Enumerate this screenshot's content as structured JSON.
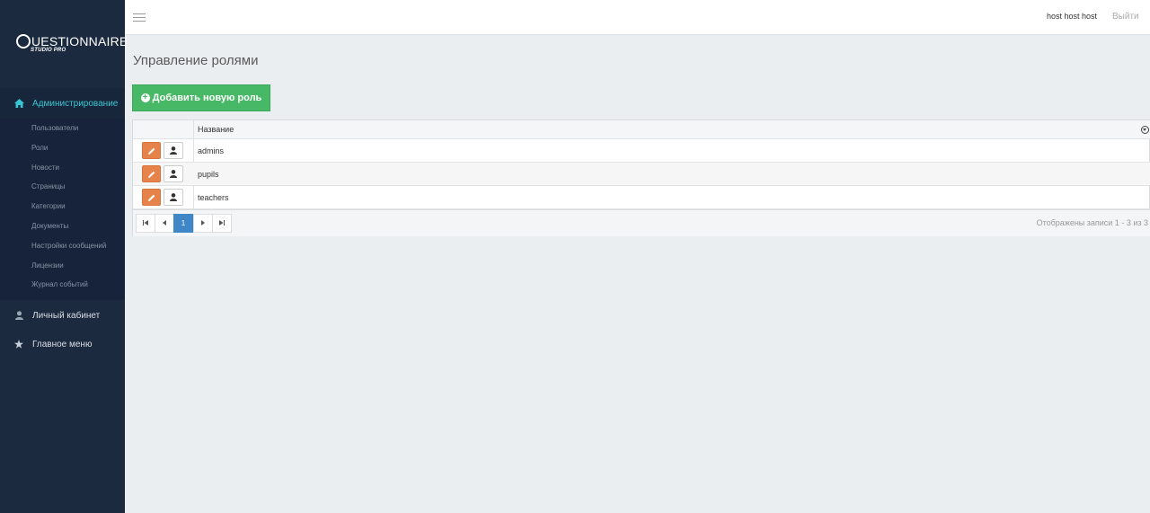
{
  "brand": {
    "name": "UESTIONNAIRE",
    "sub": "STUDIO PRO"
  },
  "header": {
    "user_name": "host host host",
    "logout": "Выйти"
  },
  "sidebar": {
    "admin": {
      "label": "Администрирование",
      "icon": "home-icon"
    },
    "sub_items": [
      "Пользователи",
      "Роли",
      "Новости",
      "Страницы",
      "Категории",
      "Документы",
      "Настройки сообщений",
      "Лицензии",
      "Журнал событий"
    ],
    "profile": {
      "label": "Личный кабинет",
      "icon": "user-icon"
    },
    "main_menu": {
      "label": "Главное меню",
      "icon": "star-icon"
    }
  },
  "main": {
    "title": "Управление ролями",
    "add_button": "Добавить новую роль",
    "grid": {
      "column_name": "Название",
      "rows": [
        "admins",
        "pupils",
        "teachers"
      ]
    },
    "pager": {
      "current_page": "1",
      "info": "Отображены записи 1 - 3 из 3"
    }
  },
  "colors": {
    "sidebar": "#1b2a3f",
    "accent": "#38c6d4",
    "add_button": "#47b966",
    "edit_button": "#e6834a",
    "active_page": "#3f87c7"
  }
}
